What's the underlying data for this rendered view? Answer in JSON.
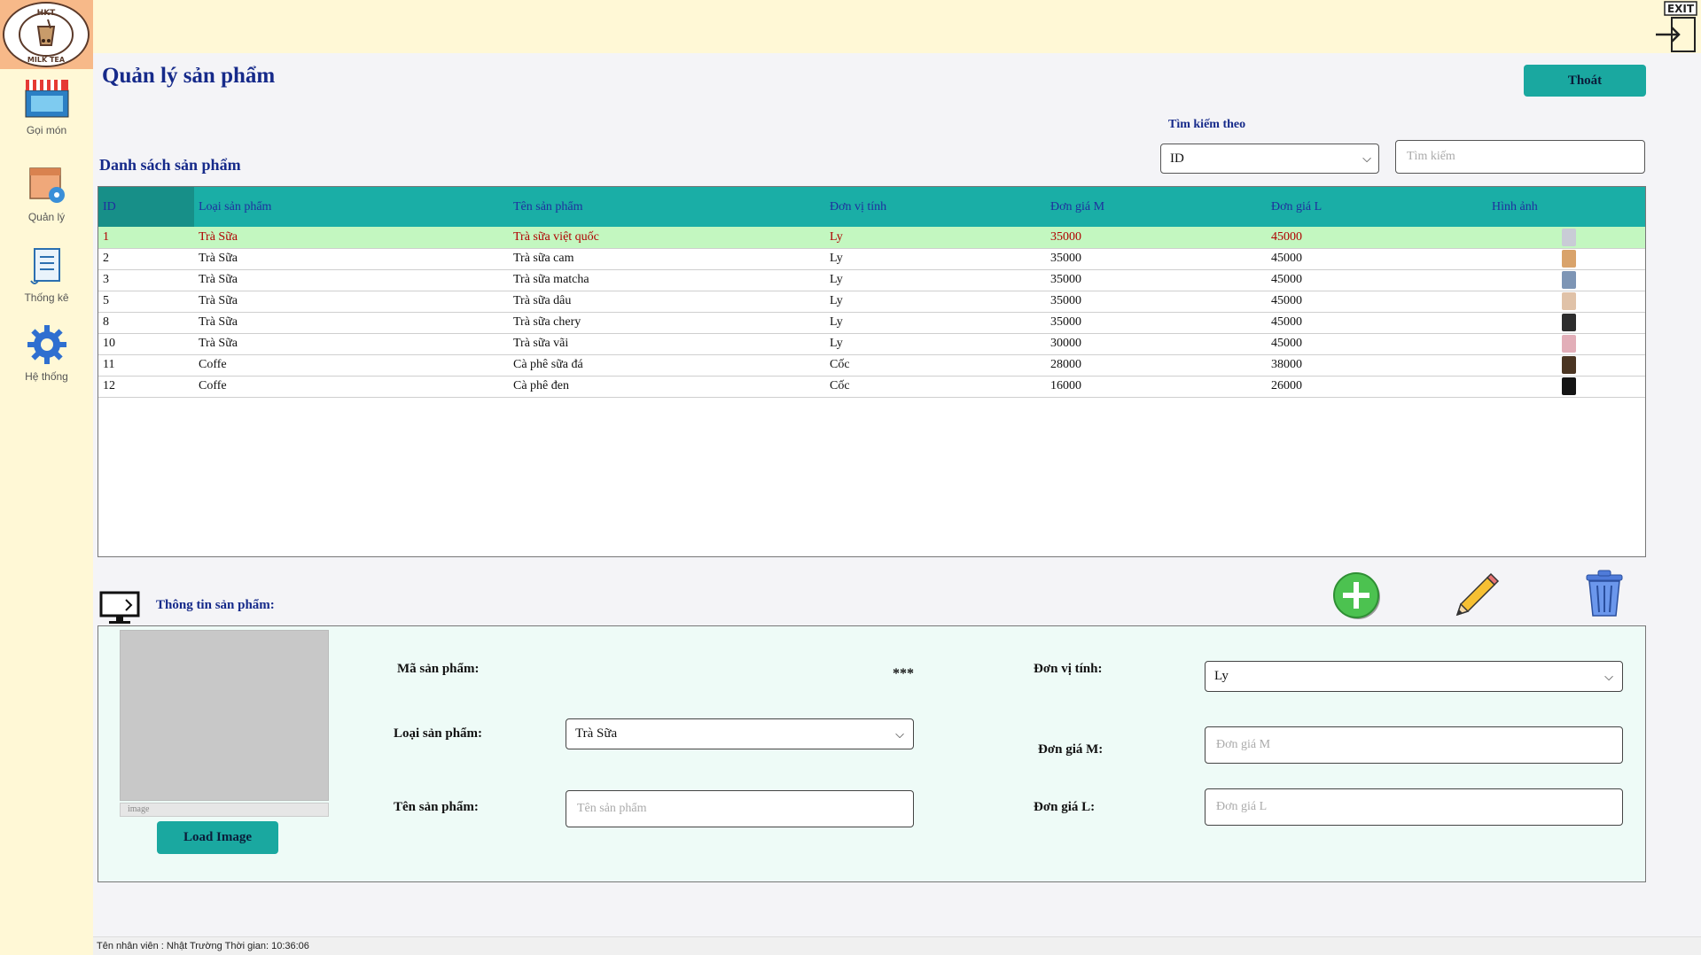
{
  "sidebar": {
    "logo_alt": "HKT MILK TEA",
    "items": [
      {
        "label": "Gọi món"
      },
      {
        "label": "Quản lý"
      },
      {
        "label": "Thống kê"
      },
      {
        "label": "Hệ thống"
      }
    ]
  },
  "header": {
    "title": "Quản lý sản phẩm",
    "exit_label": "Thoát",
    "exit_icon_text": "EXIT"
  },
  "search": {
    "label": "Tìm kiếm theo",
    "by_selected": "ID",
    "placeholder": "Tìm kiếm"
  },
  "list": {
    "title": "Danh sách sản phẩm",
    "columns": [
      "ID",
      "Loại sản phẩm",
      "Tên sản phẩm",
      "Đơn vị tính",
      "Đơn giá M",
      "Đơn giá L",
      "Hình ảnh"
    ],
    "rows": [
      {
        "id": "1",
        "type": "Trà Sữa",
        "name": "Trà sữa việt quốc",
        "unit": "Ly",
        "price_m": "35000",
        "price_l": "45000",
        "thumb": "#c9ccd6"
      },
      {
        "id": "2",
        "type": "Trà Sữa",
        "name": "Trà sữa cam",
        "unit": "Ly",
        "price_m": "35000",
        "price_l": "45000",
        "thumb": "#d9a36b"
      },
      {
        "id": "3",
        "type": "Trà Sữa",
        "name": "Trà sữa matcha",
        "unit": "Ly",
        "price_m": "35000",
        "price_l": "45000",
        "thumb": "#7d95b5"
      },
      {
        "id": "5",
        "type": "Trà Sữa",
        "name": "Trà sữa dâu",
        "unit": "Ly",
        "price_m": "35000",
        "price_l": "45000",
        "thumb": "#e0c2a8"
      },
      {
        "id": "8",
        "type": "Trà Sữa",
        "name": "Trà sữa chery",
        "unit": "Ly",
        "price_m": "35000",
        "price_l": "45000",
        "thumb": "#2d2d2d"
      },
      {
        "id": "10",
        "type": "Trà Sữa",
        "name": "Trà sữa vãi",
        "unit": "Ly",
        "price_m": "30000",
        "price_l": "45000",
        "thumb": "#e2aeb8"
      },
      {
        "id": "11",
        "type": "Coffe",
        "name": "Cà phê sữa đá",
        "unit": "Cốc",
        "price_m": "28000",
        "price_l": "38000",
        "thumb": "#4a3522"
      },
      {
        "id": "12",
        "type": "Coffe",
        "name": "Cà phê đen",
        "unit": "Cốc",
        "price_m": "16000",
        "price_l": "26000",
        "thumb": "#141414"
      }
    ]
  },
  "info": {
    "title": "Thông tin sản phẩm:",
    "image_caption": "image",
    "load_image_label": "Load Image",
    "code_label": "Mã sản phẩm:",
    "code_value": "***",
    "type_label": "Loại sản phẩm:",
    "type_value": "Trà Sữa",
    "name_label": "Tên sản phẩm:",
    "name_placeholder": "Tên sản phẩm",
    "unit_label": "Đơn vị tính:",
    "unit_value": "Ly",
    "price_m_label": "Đơn giá M:",
    "price_m_placeholder": "Đơn giá M",
    "price_l_label": "Đơn giá L:",
    "price_l_placeholder": "Đơn giá L"
  },
  "status": {
    "text": "Tên nhân viên : Nhật Trường   Thời gian: 10:36:06"
  },
  "colors": {
    "accent": "#1aa8a0",
    "title": "#162a8a",
    "sidebar_bg": "#fff8d6",
    "selected_row": "#c3f7c0"
  }
}
